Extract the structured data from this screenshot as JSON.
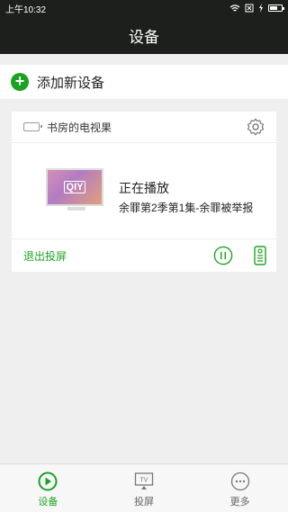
{
  "status_bar": {
    "time": "上午10:32"
  },
  "header": {
    "title": "设备"
  },
  "add_device": {
    "icon": "plus-icon",
    "label": "添加新设备"
  },
  "device_card": {
    "device_icon": "tv-box-icon",
    "device_name": "书房的电视果",
    "settings_icon": "gear-icon",
    "thumbnail_logo": "QIY",
    "status": "正在播放",
    "episode": "余罪第2季第1集-余罪被举报",
    "exit_label": "退出投屏",
    "pause_icon": "pause-icon",
    "remote_icon": "remote-icon"
  },
  "tabs": [
    {
      "label": "设备",
      "icon": "play-circle-icon",
      "active": true
    },
    {
      "label": "投屏",
      "icon": "tv-icon",
      "active": false
    },
    {
      "label": "更多",
      "icon": "more-icon",
      "active": false
    }
  ],
  "colors": {
    "accent": "#1aa321",
    "header_bg": "#1d1f1d",
    "page_bg": "#efefef"
  }
}
